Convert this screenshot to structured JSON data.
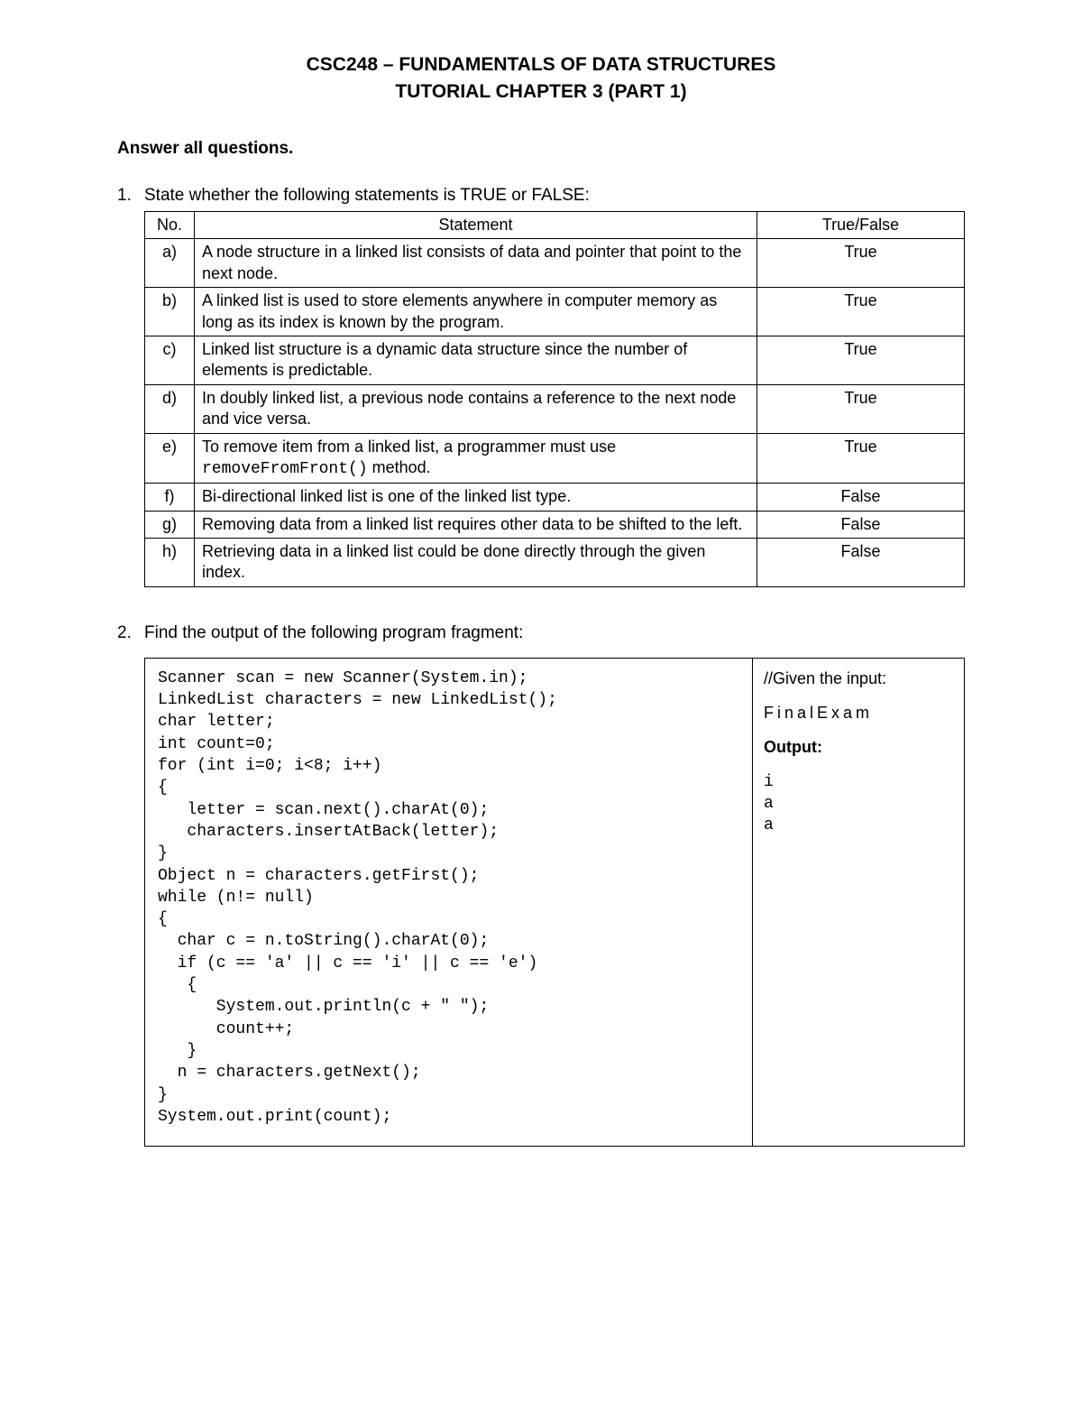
{
  "header": {
    "course_title": "CSC248 – FUNDAMENTALS OF DATA STRUCTURES",
    "tutorial_title": "TUTORIAL CHAPTER 3 (PART 1)"
  },
  "instruction": "Answer all questions.",
  "q1": {
    "num": "1.",
    "prompt": "State whether the following statements is TRUE or FALSE:",
    "headers": {
      "no": "No.",
      "stmt": "Statement",
      "tf": "True/False"
    },
    "rows": [
      {
        "no": "a)",
        "stmt": "A node structure in a linked list consists of data and pointer that point to the next node.",
        "tf": "True"
      },
      {
        "no": "b)",
        "stmt": "A linked list is used to store elements anywhere in computer memory as long as its index is known by the program.",
        "tf": "True"
      },
      {
        "no": "c)",
        "stmt": "Linked list structure is a dynamic data structure since the number of elements is predictable.",
        "tf": "True"
      },
      {
        "no": "d)",
        "stmt": "In doubly linked list, a previous node contains a reference to the next node and vice versa.",
        "tf": "True"
      },
      {
        "no": "e)",
        "stmt_pre": "To remove item from a linked list, a programmer must use ",
        "stmt_code": "removeFromFront()",
        "stmt_post": " method.",
        "tf": "True"
      },
      {
        "no": "f)",
        "stmt": "Bi-directional linked list is one of the linked list type.",
        "tf": "False"
      },
      {
        "no": "g)",
        "stmt": "Removing data from a linked list requires other data to be shifted to the left.",
        "tf": "False"
      },
      {
        "no": "h)",
        "stmt": "Retrieving data in a linked list could be done directly through the given index.",
        "tf": "False"
      }
    ]
  },
  "q2": {
    "num": "2.",
    "prompt": "Find the output of the following program fragment:",
    "code": "Scanner scan = new Scanner(System.in);\nLinkedList characters = new LinkedList();\nchar letter;\nint count=0;\nfor (int i=0; i<8; i++)\n{\n   letter = scan.next().charAt(0);\n   characters.insertAtBack(letter);\n}\nObject n = characters.getFirst();\nwhile (n!= null)\n{\n  char c = n.toString().charAt(0);\n  if (c == 'a' || c == 'i' || c == 'e')\n   {\n      System.out.println(c + \" \");\n      count++;\n   }\n  n = characters.getNext();\n}\nSystem.out.print(count);\n",
    "output": {
      "given_label": "//Given the input:",
      "given_value": "FinalExam",
      "output_label": "Output:",
      "lines": [
        "i",
        "a",
        "a"
      ]
    }
  }
}
